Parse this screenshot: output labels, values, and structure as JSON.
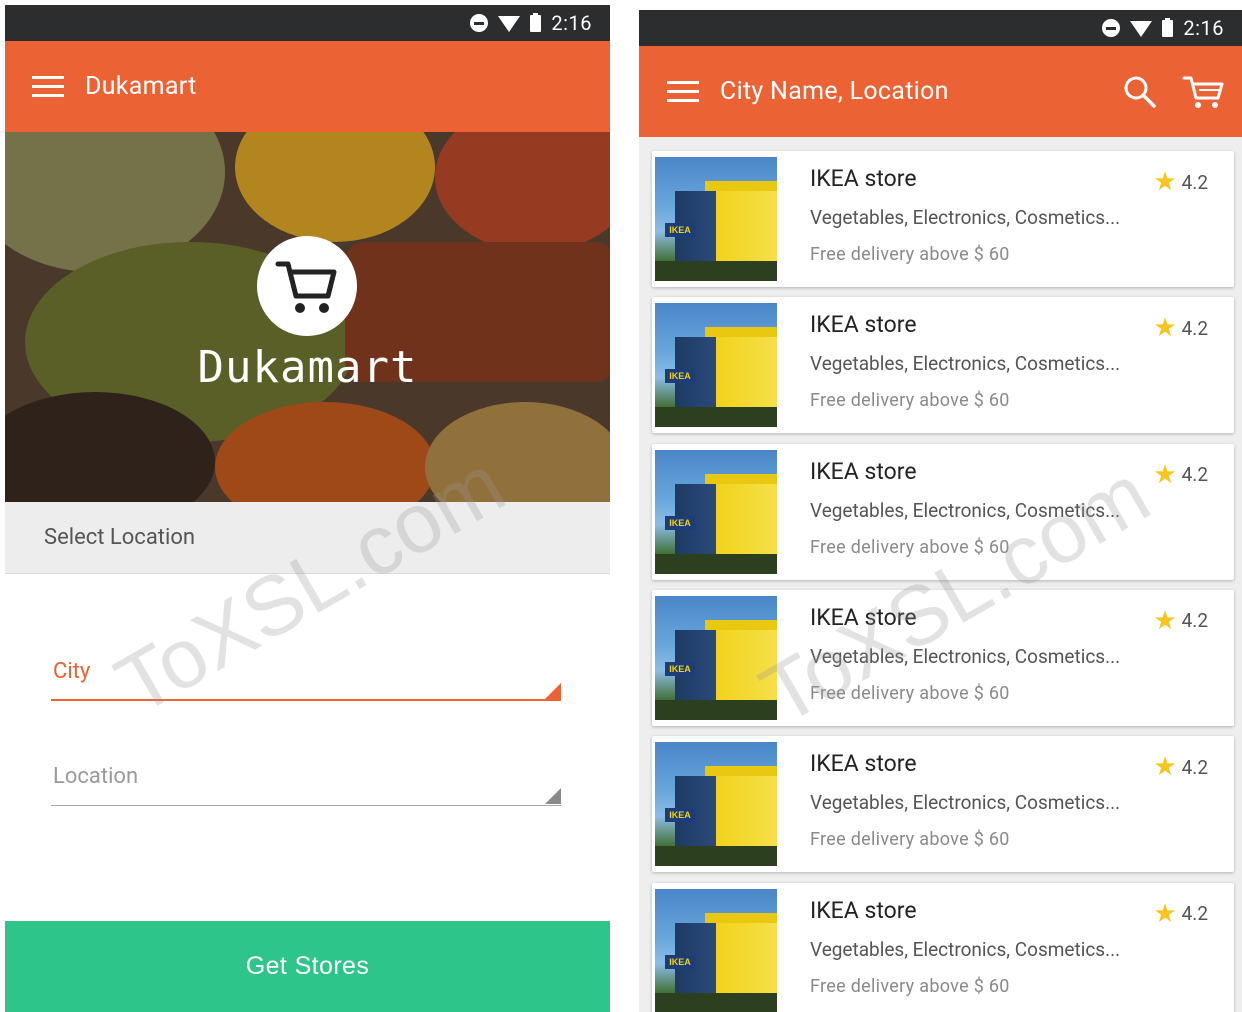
{
  "left_screen": {
    "status_bar": {
      "time": "2:16"
    },
    "app_bar": {
      "title": "Dukamart"
    },
    "hero": {
      "logo_text": "Dukamart"
    },
    "select_location": {
      "label": "Select Location"
    },
    "city_field": {
      "placeholder": "City"
    },
    "location_field": {
      "placeholder": "Location"
    },
    "get_stores_button": {
      "label": "Get Stores"
    }
  },
  "right_screen": {
    "status_bar": {
      "time": "2:16"
    },
    "app_bar": {
      "title": "City Name, Location"
    },
    "stores": [
      {
        "name": "IKEA store",
        "categories": "Vegetables, Electronics, Cosmetics...",
        "delivery": "Free delivery above $ 60",
        "rating": "4.2"
      },
      {
        "name": "IKEA store",
        "categories": "Vegetables, Electronics, Cosmetics...",
        "delivery": "Free delivery above $ 60",
        "rating": "4.2"
      },
      {
        "name": "IKEA store",
        "categories": "Vegetables, Electronics, Cosmetics...",
        "delivery": "Free delivery above $ 60",
        "rating": "4.2"
      },
      {
        "name": "IKEA store",
        "categories": "Vegetables, Electronics, Cosmetics...",
        "delivery": "Free delivery above $ 60",
        "rating": "4.2"
      },
      {
        "name": "IKEA store",
        "categories": "Vegetables, Electronics, Cosmetics...",
        "delivery": "Free delivery above $ 60",
        "rating": "4.2"
      },
      {
        "name": "IKEA store",
        "categories": "Vegetables, Electronics, Cosmetics...",
        "delivery": "Free delivery above $ 60",
        "rating": "4.2"
      }
    ]
  },
  "watermark": "ToXSL.com",
  "icons": {
    "menu": "hamburger-menu-icon",
    "search": "search-icon",
    "cart": "shopping-cart-icon",
    "star": "star-icon",
    "logo": "shopping-cart-logo-icon"
  },
  "colors": {
    "primary": "#eb6235",
    "accent_button": "#2dc589",
    "status_bar": "#2b2d2f",
    "star": "#f7c51b"
  }
}
